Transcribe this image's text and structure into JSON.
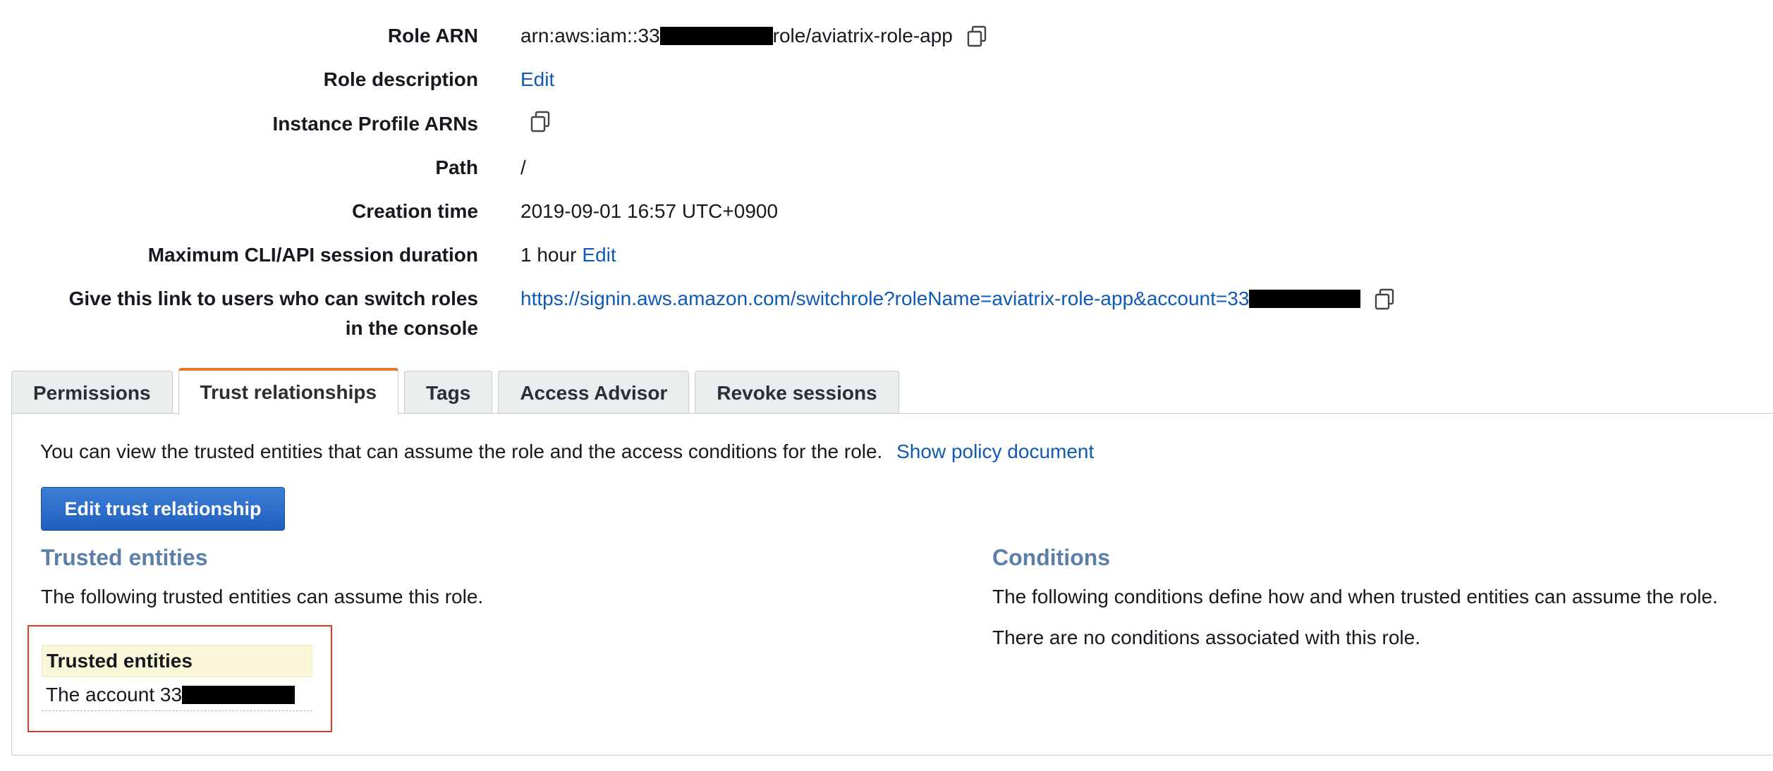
{
  "summary": {
    "role_arn": {
      "label": "Role ARN",
      "prefix": "arn:aws:iam::33",
      "suffix": "role/aviatrix-role-app"
    },
    "role_description": {
      "label": "Role description",
      "edit_label": "Edit"
    },
    "instance_profile_arns": {
      "label": "Instance Profile ARNs"
    },
    "path": {
      "label": "Path",
      "value": "/"
    },
    "creation_time": {
      "label": "Creation time",
      "value": "2019-09-01 16:57 UTC+0900"
    },
    "max_session": {
      "label": "Maximum CLI/API session duration",
      "value": "1 hour",
      "edit_label": "Edit"
    },
    "switch_link": {
      "label_line1": "Give this link to users who can switch roles",
      "label_line2": "in the console",
      "url_prefix": "https://signin.aws.amazon.com/switchrole?roleName=aviatrix-role-app&account=33"
    }
  },
  "tabs": [
    {
      "label": "Permissions",
      "active": false
    },
    {
      "label": "Trust relationships",
      "active": true
    },
    {
      "label": "Tags",
      "active": false
    },
    {
      "label": "Access Advisor",
      "active": false
    },
    {
      "label": "Revoke sessions",
      "active": false
    }
  ],
  "panel": {
    "intro_text": "You can view the trusted entities that can assume the role and the access conditions for the role.",
    "show_policy_link": "Show policy document",
    "edit_button_label": "Edit trust relationship",
    "trusted": {
      "title": "Trusted entities",
      "description": "The following trusted entities can assume this role.",
      "table_header": "Trusted entities",
      "entity_prefix": "The account 33"
    },
    "conditions": {
      "title": "Conditions",
      "description": "The following conditions define how and when trusted entities can assume the role.",
      "empty_text": "There are no conditions associated with this role."
    }
  },
  "colors": {
    "link": "#0f5ab3",
    "active_tab_accent": "#e07b2c",
    "section_title": "#5b7fa8",
    "primary_button": "#1f5fbf",
    "highlight_box": "#e0362a",
    "table_header_bg": "#fbf8da"
  },
  "icons": {
    "copy": "copy-clipboard-icon",
    "redaction": "redaction-bar"
  }
}
